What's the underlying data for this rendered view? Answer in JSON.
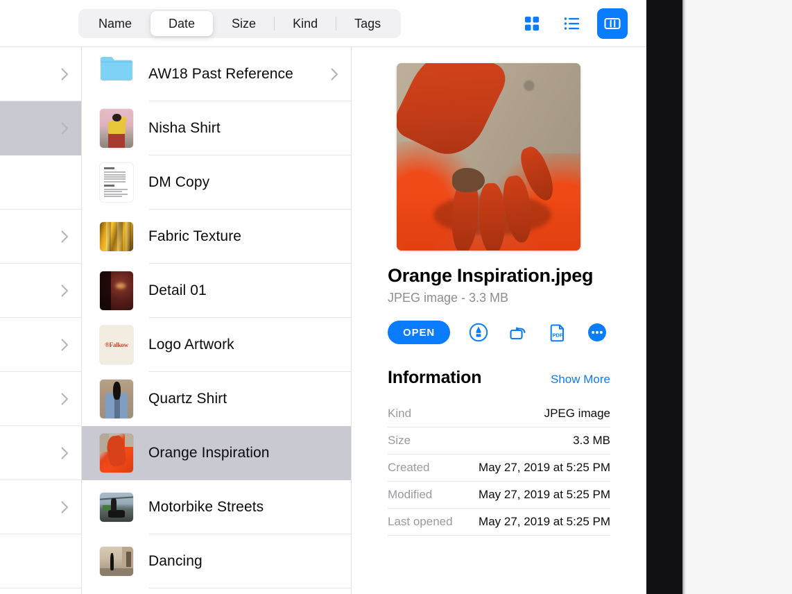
{
  "toolbar": {
    "sort_tabs": [
      {
        "label": "Name",
        "active": false
      },
      {
        "label": "Date",
        "active": true
      },
      {
        "label": "Size",
        "active": false
      },
      {
        "label": "Kind",
        "active": false
      },
      {
        "label": "Tags",
        "active": false
      }
    ],
    "view_modes": [
      {
        "name": "grid-view",
        "label": "Grid view",
        "active": false
      },
      {
        "name": "list-view",
        "label": "List view",
        "active": false
      },
      {
        "name": "column-view",
        "label": "Column view",
        "active": true
      }
    ]
  },
  "colors": {
    "accent": "#0a7cff",
    "selection": "#c9c9d1",
    "separator": "#e5e5e7",
    "secondary_text": "#8d8d92",
    "background": "#ffffff"
  },
  "parent_column": {
    "rows": [
      {
        "has_chevron": true,
        "selected": false
      },
      {
        "has_chevron": true,
        "selected": true
      },
      {
        "has_chevron": false,
        "selected": false
      },
      {
        "has_chevron": true,
        "selected": false
      },
      {
        "has_chevron": true,
        "selected": false
      },
      {
        "has_chevron": true,
        "selected": false
      },
      {
        "has_chevron": true,
        "selected": false
      },
      {
        "has_chevron": true,
        "selected": false
      },
      {
        "has_chevron": true,
        "selected": false
      },
      {
        "has_chevron": false,
        "selected": false
      }
    ]
  },
  "file_list": {
    "items": [
      {
        "name": "AW18 Past Reference",
        "icon": "folder-icon",
        "art": "folder",
        "chevron": true,
        "selected": false
      },
      {
        "name": "Nisha Shirt",
        "icon": "image-thumbnail",
        "art": "nisha",
        "chevron": false,
        "selected": false
      },
      {
        "name": "DM Copy",
        "icon": "document-thumbnail",
        "art": "doc",
        "chevron": false,
        "selected": false
      },
      {
        "name": "Fabric Texture",
        "icon": "image-thumbnail",
        "art": "fabric",
        "chevron": false,
        "selected": false
      },
      {
        "name": "Detail 01",
        "icon": "image-thumbnail",
        "art": "detail",
        "chevron": false,
        "selected": false
      },
      {
        "name": "Logo Artwork",
        "icon": "image-thumbnail",
        "art": "falkow",
        "chevron": false,
        "selected": false,
        "logo_text": "Falkow"
      },
      {
        "name": "Quartz Shirt",
        "icon": "image-thumbnail",
        "art": "quartz",
        "chevron": false,
        "selected": false
      },
      {
        "name": "Orange Inspiration",
        "icon": "image-thumbnail",
        "art": "orange",
        "chevron": false,
        "selected": true
      },
      {
        "name": "Motorbike Streets",
        "icon": "image-thumbnail",
        "art": "moto",
        "chevron": false,
        "selected": false
      },
      {
        "name": "Dancing",
        "icon": "image-thumbnail",
        "art": "dance",
        "chevron": false,
        "selected": false
      }
    ]
  },
  "preview": {
    "image_alt": "Hand covered in orange powder on concrete",
    "title": "Orange Inspiration.jpeg",
    "subtitle": "JPEG image - 3.3 MB",
    "open_label": "OPEN",
    "actions": [
      {
        "name": "markup-icon",
        "label": "Markup"
      },
      {
        "name": "rotate-icon",
        "label": "Rotate"
      },
      {
        "name": "pdf-icon",
        "label": "Create PDF"
      },
      {
        "name": "more-icon",
        "label": "More"
      }
    ],
    "information": {
      "heading": "Information",
      "show_more_label": "Show More",
      "rows": [
        {
          "key": "Kind",
          "value": "JPEG image"
        },
        {
          "key": "Size",
          "value": "3.3 MB"
        },
        {
          "key": "Created",
          "value": "May 27, 2019 at 5:25 PM"
        },
        {
          "key": "Modified",
          "value": "May 27, 2019 at 5:25 PM"
        },
        {
          "key": "Last opened",
          "value": "May 27, 2019 at 5:25 PM"
        }
      ]
    }
  }
}
